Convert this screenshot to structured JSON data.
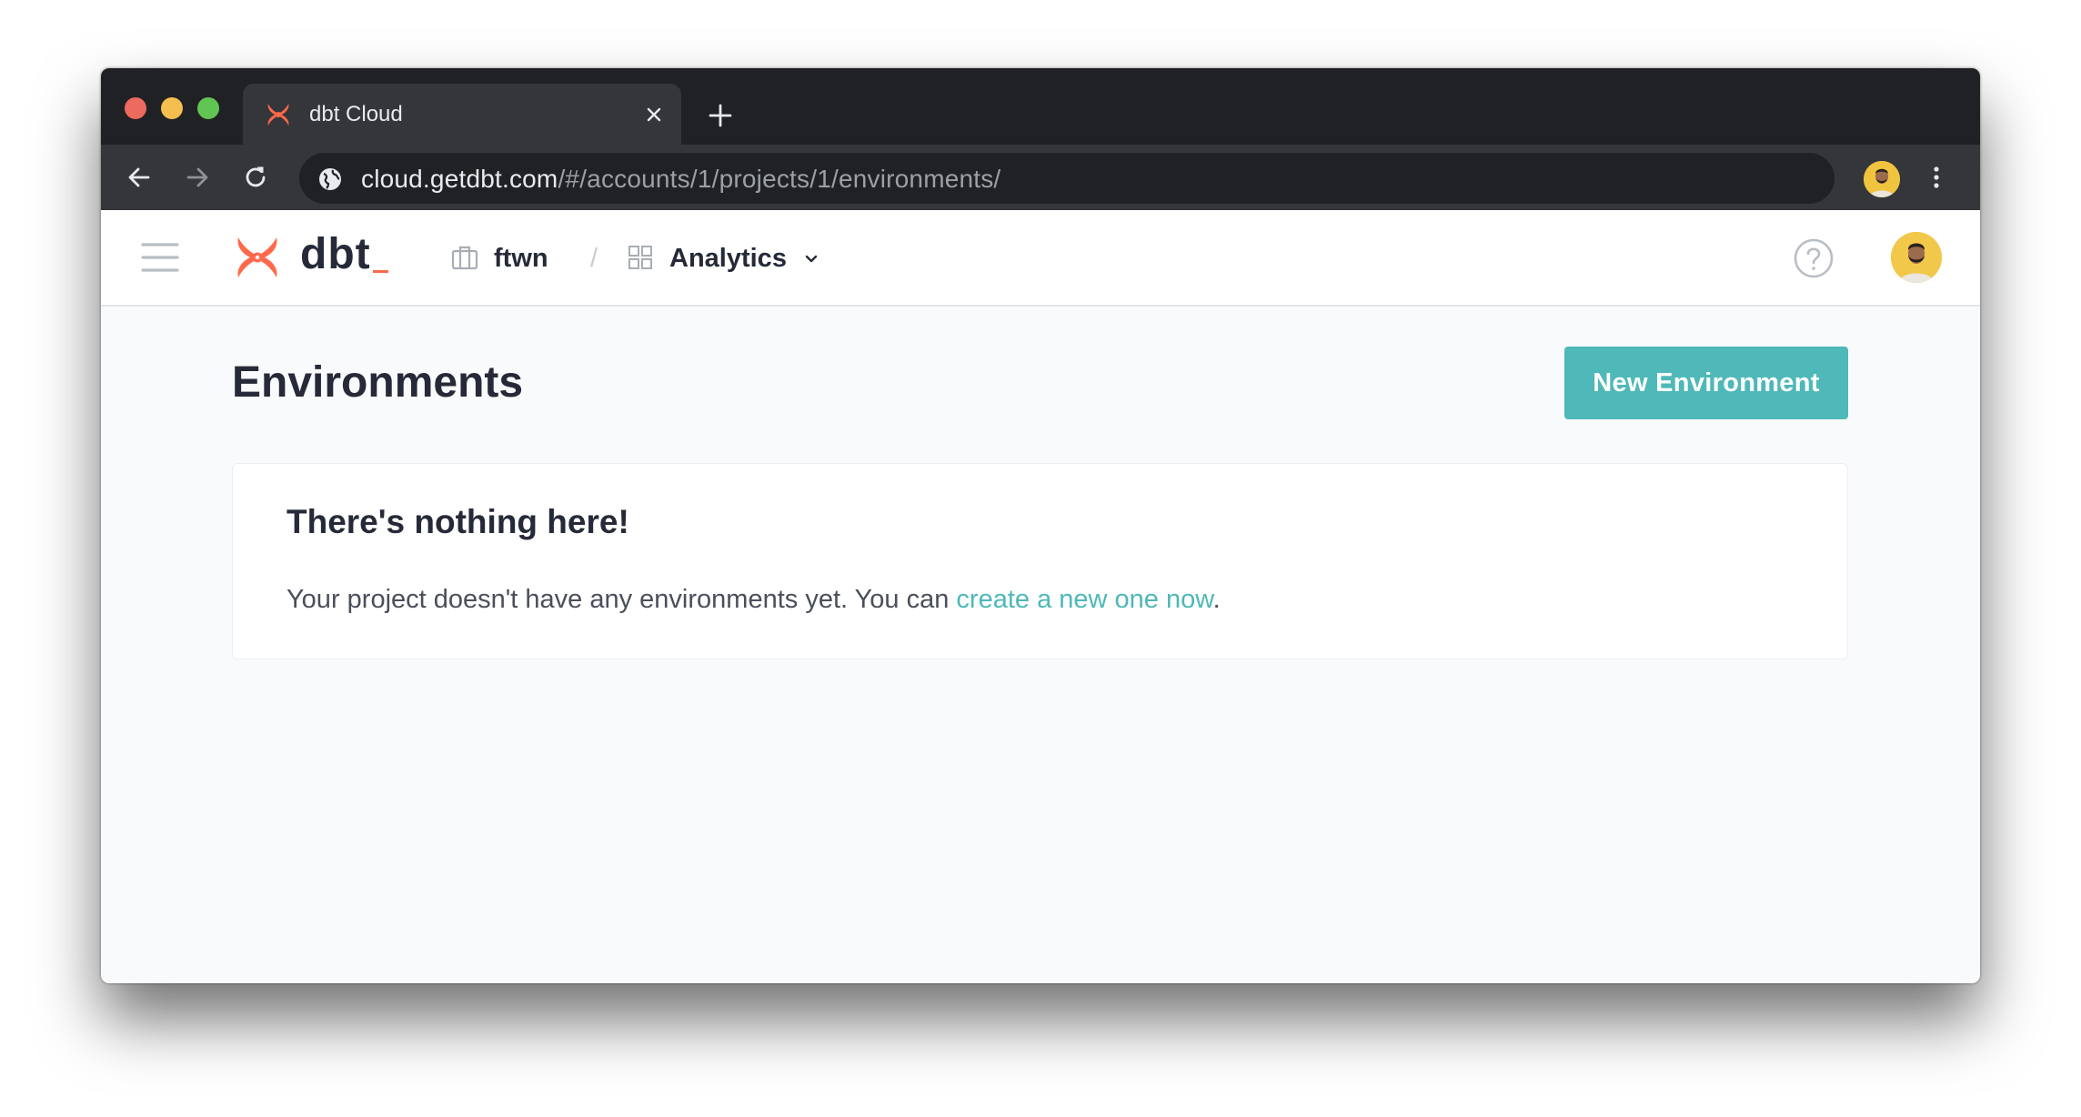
{
  "browser": {
    "tab_title": "dbt Cloud",
    "url_host": "cloud.getdbt.com",
    "url_path": "/#/accounts/1/projects/1/environments/"
  },
  "app": {
    "brand": "dbt",
    "brand_color": "#ff694b",
    "accent_color": "#4fb8b8",
    "breadcrumb": {
      "org": "ftwn",
      "separator": "/",
      "project": "Analytics"
    },
    "icons": [
      "hamburger-menu-icon",
      "briefcase-icon",
      "grid-icon",
      "chevron-down-icon",
      "help-circle-icon",
      "user-avatar"
    ]
  },
  "page": {
    "title": "Environments",
    "new_button": "New Environment",
    "empty_state": {
      "heading": "There's nothing here!",
      "text_before": "Your project doesn't have any environments yet. You can ",
      "link_text": "create a new one now",
      "text_after": "."
    }
  }
}
